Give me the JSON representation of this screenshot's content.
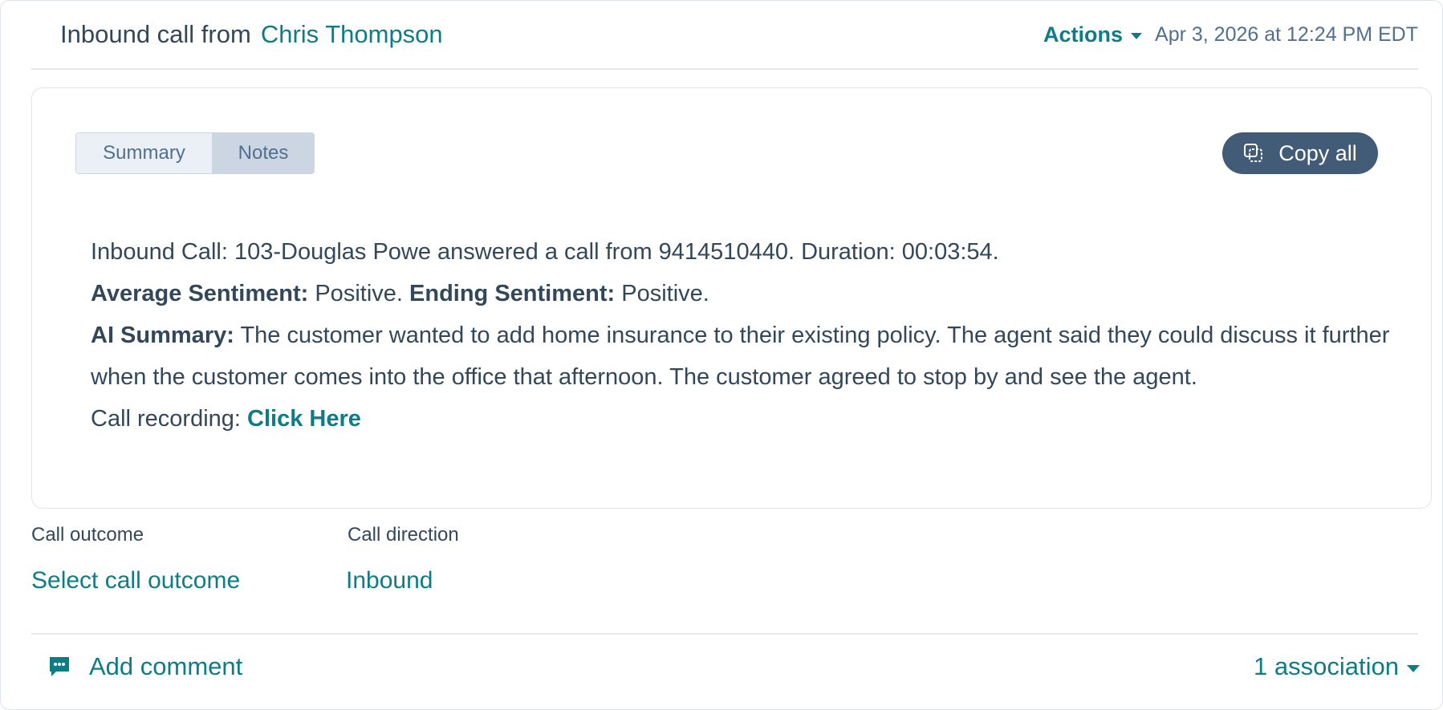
{
  "header": {
    "prefix": "Inbound call from",
    "contact_name": "Chris Thompson",
    "actions_label": "Actions",
    "timestamp": "Apr 3, 2026 at 12:24 PM EDT"
  },
  "note": {
    "tabs": [
      "Summary",
      "Notes"
    ],
    "selected_tab": "Notes",
    "copy_label": "Copy all",
    "line1": "Inbound Call: 103-Douglas Powe answered a call from 9414510440. Duration: 00:03:54.",
    "avg_sentiment_label": "Average Sentiment:",
    "avg_sentiment_value": "Positive.",
    "end_sentiment_label": "Ending Sentiment:",
    "end_sentiment_value": "Positive.",
    "ai_summary_label": "AI Summary:",
    "ai_summary_text": "The customer wanted to add home insurance to their existing policy. The agent said they could discuss it further when the customer comes into the office that afternoon. The customer agreed to stop by and see the agent.",
    "recording_label": "Call recording:",
    "recording_link": "Click Here"
  },
  "fields": {
    "outcome_label": "Call outcome",
    "outcome_value": "Select call outcome",
    "direction_label": "Call direction",
    "direction_value": "Inbound"
  },
  "footer": {
    "add_comment_label": "Add comment",
    "association_label": "1 association"
  },
  "colors": {
    "accent": "#0e7c86",
    "text": "#33475b",
    "button_dark": "#425b76"
  },
  "icons": {
    "copy": "copy-icon",
    "comment": "comment-icon",
    "caret": "chevron-down-icon"
  }
}
